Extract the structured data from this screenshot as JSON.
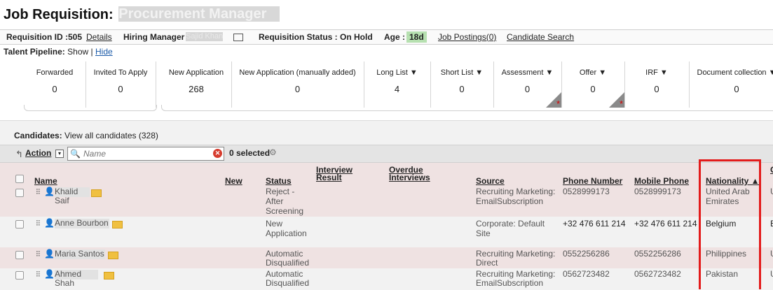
{
  "page": {
    "title_prefix": "Job Requisition:",
    "title_redacted": "Procurement Manager"
  },
  "reqbar": {
    "req_id": "Requisition ID :505",
    "details": "Details",
    "hiring_label": "Hiring Manager",
    "hiring_name": "Sajid Khan",
    "status": "Requisition Status : On Hold",
    "age_label": "Age :",
    "age_value": "18d",
    "postings": "Job Postings(0)",
    "search": "Candidate Search"
  },
  "pipeline": {
    "label": "Talent Pipeline:",
    "show": "Show",
    "sep": "|",
    "hide": "Hide",
    "stages": [
      {
        "label": "Forwarded",
        "count": "0"
      },
      {
        "label": "Invited To Apply",
        "count": "0"
      },
      {
        "label": "New Application",
        "count": "268"
      },
      {
        "label": "New Application (manually added)",
        "count": "0"
      },
      {
        "label": "Long List ▼",
        "count": "4"
      },
      {
        "label": "Short List ▼",
        "count": "0"
      },
      {
        "label": "Assessment ▼",
        "count": "0"
      },
      {
        "label": "Offer ▼",
        "count": "0"
      },
      {
        "label": "IRF ▼",
        "count": "0"
      },
      {
        "label": "Document collection ▼",
        "count": "0"
      }
    ]
  },
  "candidates": {
    "label": "Candidates:",
    "view_all": "View all candidates (328)",
    "action": "Action",
    "search_placeholder": "Name",
    "selected": "0 selected"
  },
  "grid": {
    "headers": {
      "name": "Name",
      "new": "New",
      "status": "Status",
      "interview1": "Interview",
      "interview2": "Result",
      "overdue1": "Overdue",
      "overdue2": "Interviews",
      "source": "Source",
      "phone": "Phone Number",
      "mobile": "Mobile Phone",
      "nationality": "Nationality ▲",
      "more": "C"
    },
    "rows": [
      {
        "name": "Khalid Saif",
        "status": [
          "Reject -",
          "After",
          "Screening"
        ],
        "source": [
          "Recruiting Marketing:",
          "EmailSubscription"
        ],
        "phone": "0528999173",
        "mobile": "0528999173",
        "nationality": [
          "United Arab",
          "Emirates"
        ],
        "extra": "U"
      },
      {
        "name": "Anne Bourbon",
        "status": [
          "New",
          "Application"
        ],
        "source": [
          "Corporate: Default",
          "Site"
        ],
        "phone": "+32 476 611 214",
        "mobile": "+32 476 611 214",
        "nationality": [
          "Belgium"
        ],
        "extra": "E"
      },
      {
        "name": "Maria Santos",
        "status": [
          "Automatic",
          "Disqualified"
        ],
        "source": [
          "Recruiting Marketing:",
          "Direct"
        ],
        "phone": "0552256286",
        "mobile": "0552256286",
        "nationality": [
          "Philippines"
        ],
        "extra": "U"
      },
      {
        "name": "Ahmed Shah",
        "status": [
          "Automatic",
          "Disqualified"
        ],
        "source": [
          "Recruiting Marketing:",
          "EmailSubscription"
        ],
        "phone": "0562723482",
        "mobile": "0562723482",
        "nationality": [
          "Pakistan"
        ],
        "extra": "U"
      }
    ]
  }
}
